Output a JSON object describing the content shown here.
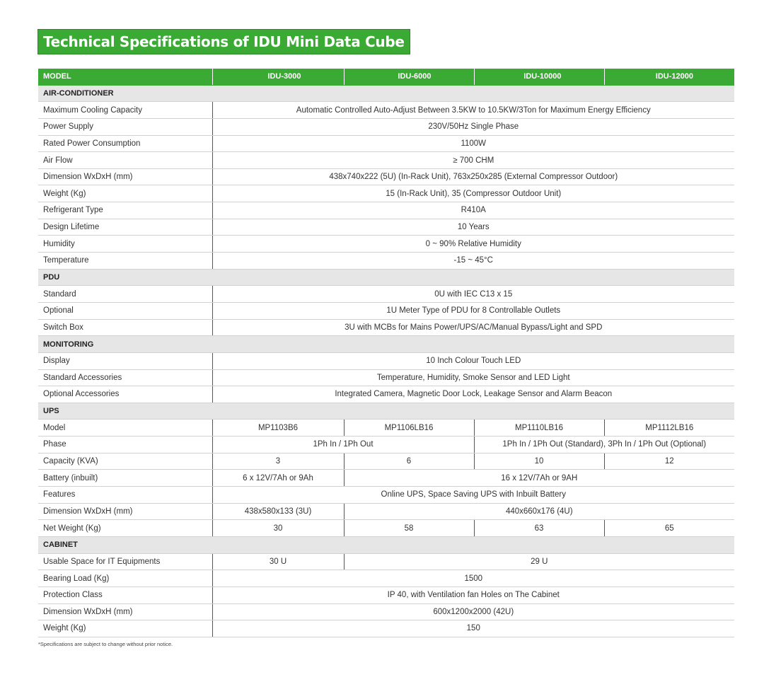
{
  "title": "Technical Specifications of IDU Mini Data Cube",
  "header": {
    "label": "MODEL",
    "models": [
      "IDU-3000",
      "IDU-6000",
      "IDU-10000",
      "IDU-12000"
    ]
  },
  "sections": {
    "air_conditioner": {
      "heading": "AIR-CONDITIONER",
      "rows": [
        {
          "label": "Maximum Cooling Capacity",
          "value": "Automatic Controlled Auto-Adjust Between 3.5KW to 10.5KW/3Ton for Maximum Energy Efficiency"
        },
        {
          "label": "Power Supply",
          "value": "230V/50Hz Single Phase"
        },
        {
          "label": "Rated Power Consumption",
          "value": "1100W"
        },
        {
          "label": "Air Flow",
          "value": "≥ 700 CHM"
        },
        {
          "label": "Dimension WxDxH (mm)",
          "value": "438x740x222 (5U) (In-Rack Unit), 763x250x285 (External Compressor Outdoor)"
        },
        {
          "label": "Weight (Kg)",
          "value": "15 (In-Rack Unit), 35 (Compressor Outdoor Unit)"
        },
        {
          "label": "Refrigerant Type",
          "value": "R410A"
        },
        {
          "label": "Design Lifetime",
          "value": "10 Years"
        },
        {
          "label": "Humidity",
          "value": "0 ~ 90% Relative Humidity"
        },
        {
          "label": "Temperature",
          "value": "-15 ~ 45°C"
        }
      ]
    },
    "pdu": {
      "heading": "PDU",
      "rows": [
        {
          "label": "Standard",
          "value": "0U with IEC C13 x 15"
        },
        {
          "label": "Optional",
          "value": "1U Meter Type of PDU for 8 Controllable Outlets"
        },
        {
          "label": "Switch Box",
          "value": "3U with MCBs for Mains Power/UPS/AC/Manual Bypass/Light and SPD"
        }
      ]
    },
    "monitoring": {
      "heading": "MONITORING",
      "rows": [
        {
          "label": "Display",
          "value": "10 Inch Colour Touch LED"
        },
        {
          "label": "Standard Accessories",
          "value": "Temperature, Humidity, Smoke Sensor and LED Light"
        },
        {
          "label": "Optional Accessories",
          "value": "Integrated Camera, Magnetic Door Lock, Leakage Sensor and Alarm Beacon"
        }
      ]
    },
    "ups": {
      "heading": "UPS",
      "model": {
        "label": "Model",
        "values": [
          "MP1103B6",
          "MP1106LB16",
          "MP1110LB16",
          "MP1112LB16"
        ]
      },
      "phase": {
        "label": "Phase",
        "values": [
          "1Ph In / 1Ph Out",
          "1Ph In / 1Ph Out (Standard), 3Ph In / 1Ph Out (Optional)"
        ]
      },
      "capacity": {
        "label": "Capacity (KVA)",
        "values": [
          "3",
          "6",
          "10",
          "12"
        ]
      },
      "battery": {
        "label": "Battery (inbuilt)",
        "values": [
          "6 x 12V/7Ah or 9Ah",
          "16 x 12V/7Ah or 9AH"
        ]
      },
      "features": {
        "label": "Features",
        "value": "Online UPS, Space Saving UPS with Inbuilt Battery"
      },
      "dimension": {
        "label": "Dimension WxDxH (mm)",
        "values": [
          "438x580x133 (3U)",
          "440x660x176 (4U)"
        ]
      },
      "net_weight": {
        "label": "Net Weight (Kg)",
        "values": [
          "30",
          "58",
          "63",
          "65"
        ]
      }
    },
    "cabinet": {
      "heading": "CABINET",
      "usable_space": {
        "label": "Usable Space for IT Equipments",
        "values": [
          "30 U",
          "29 U"
        ]
      },
      "rows": [
        {
          "label": "Bearing Load (Kg)",
          "value": "1500"
        },
        {
          "label": "Protection Class",
          "value": "IP 40, with Ventilation fan Holes on The Cabinet"
        },
        {
          "label": "Dimension WxDxH (mm)",
          "value": "600x1200x2000 (42U)"
        },
        {
          "label": "Weight (Kg)",
          "value": "150"
        }
      ]
    }
  },
  "footnote": "*Specifications are subject to change without prior notice.",
  "colors": {
    "accent": "#3aaa35",
    "section_bg": "#e6e6e6"
  }
}
